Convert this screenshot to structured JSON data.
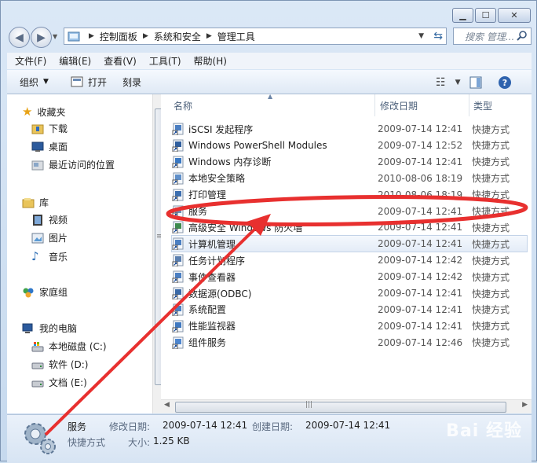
{
  "window": {
    "minimize": "▁",
    "maximize": "☐",
    "close": "✕"
  },
  "address": {
    "crumbs": [
      "控制面板",
      "系统和安全",
      "管理工具"
    ],
    "search_placeholder": "搜索 管理..."
  },
  "menu": [
    "文件(F)",
    "编辑(E)",
    "查看(V)",
    "工具(T)",
    "帮助(H)"
  ],
  "toolbar": {
    "organize": "组织",
    "open": "打开",
    "burn": "刻录"
  },
  "nav": {
    "favorites": "收藏夹",
    "downloads": "下载",
    "desktop": "桌面",
    "recent": "最近访问的位置",
    "libraries": "库",
    "videos": "视频",
    "pictures": "图片",
    "music": "音乐",
    "homegroup": "家庭组",
    "computer": "我的电脑",
    "drive_c": "本地磁盘 (C:)",
    "drive_d": "软件 (D:)",
    "drive_e": "文档 (E:)"
  },
  "columns": {
    "name": "名称",
    "date": "修改日期",
    "type": "类型"
  },
  "files": [
    {
      "name": "iSCSI 发起程序",
      "date": "2009-07-14 12:41",
      "type": "快捷方式"
    },
    {
      "name": "Windows PowerShell Modules",
      "date": "2009-07-14 12:52",
      "type": "快捷方式"
    },
    {
      "name": "Windows 内存诊断",
      "date": "2009-07-14 12:41",
      "type": "快捷方式"
    },
    {
      "name": "本地安全策略",
      "date": "2010-08-06 18:19",
      "type": "快捷方式"
    },
    {
      "name": "打印管理",
      "date": "2010-08-06 18:19",
      "type": "快捷方式"
    },
    {
      "name": "服务",
      "date": "2009-07-14 12:41",
      "type": "快捷方式"
    },
    {
      "name": "高级安全 Windows 防火墙",
      "date": "2009-07-14 12:41",
      "type": "快捷方式"
    },
    {
      "name": "计算机管理",
      "date": "2009-07-14 12:41",
      "type": "快捷方式"
    },
    {
      "name": "任务计划程序",
      "date": "2009-07-14 12:42",
      "type": "快捷方式"
    },
    {
      "name": "事件查看器",
      "date": "2009-07-14 12:42",
      "type": "快捷方式"
    },
    {
      "name": "数据源(ODBC)",
      "date": "2009-07-14 12:41",
      "type": "快捷方式"
    },
    {
      "name": "系统配置",
      "date": "2009-07-14 12:41",
      "type": "快捷方式"
    },
    {
      "name": "性能监视器",
      "date": "2009-07-14 12:41",
      "type": "快捷方式"
    },
    {
      "name": "组件服务",
      "date": "2009-07-14 12:46",
      "type": "快捷方式"
    }
  ],
  "details": {
    "name": "服务",
    "kind": "快捷方式",
    "modified_label": "修改日期:",
    "modified": "2009-07-14 12:41",
    "created_label": "创建日期:",
    "created": "2009-07-14 12:41",
    "size_label": "大小:",
    "size": "1.25 KB"
  },
  "watermark": "Bai 经验",
  "colors": {
    "annotation": "#e8302f",
    "selection": "#e4ecf7"
  }
}
